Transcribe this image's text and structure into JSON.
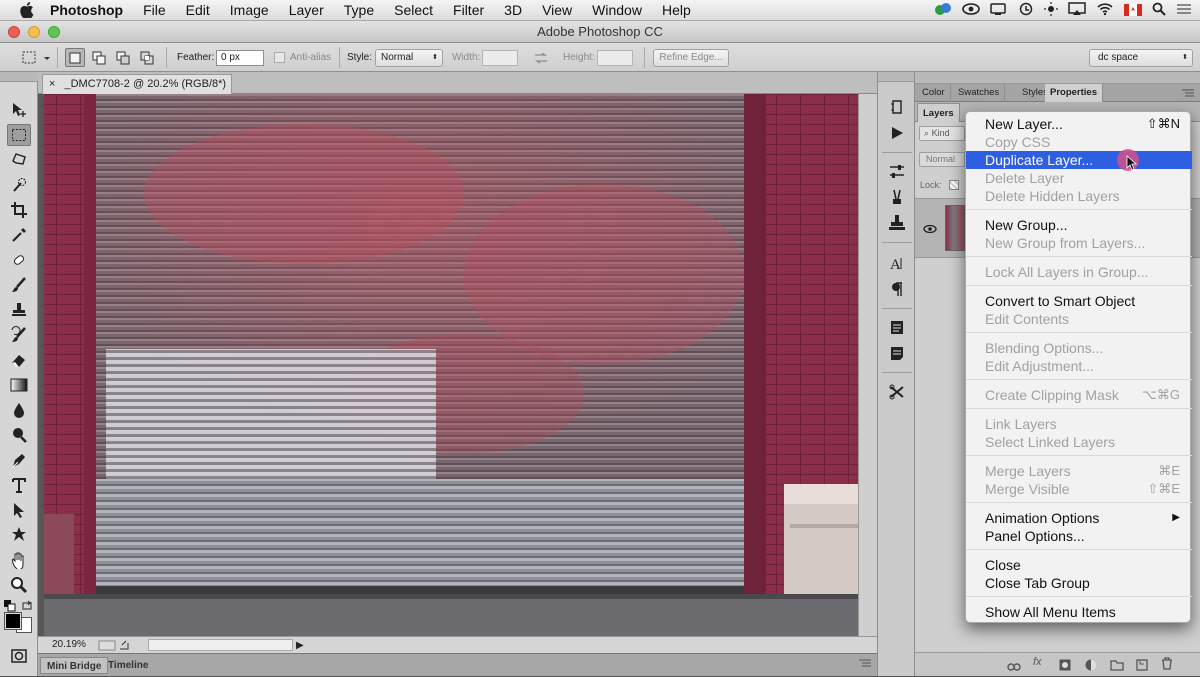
{
  "mac_menubar": {
    "app_name": "Photoshop",
    "items": [
      "File",
      "Edit",
      "Image",
      "Layer",
      "Type",
      "Select",
      "Filter",
      "3D",
      "View",
      "Window",
      "Help"
    ]
  },
  "window": {
    "title": "Adobe Photoshop CC"
  },
  "options_bar": {
    "feather_label": "Feather:",
    "feather_value": "0 px",
    "anti_alias_label": "Anti-alias",
    "style_label": "Style:",
    "style_value": "Normal",
    "width_label": "Width:",
    "height_label": "Height:",
    "refine_edge_label": "Refine Edge...",
    "workspace_value": "dc space"
  },
  "document": {
    "tab_label": "_DMC7708-2 @ 20.2% (RGB/8*)",
    "zoom_display": "20.19%"
  },
  "bottom_tabs": [
    "Mini Bridge",
    "Timeline"
  ],
  "right_panel": {
    "top_tabs": [
      "Color",
      "Swatches",
      "Styles",
      "Properties"
    ],
    "layers_tab": "Layers",
    "kind_label": "Kind",
    "blend_mode": "Normal",
    "lock_label": "Lock:"
  },
  "context_menu": {
    "items": [
      {
        "label": "New Layer...",
        "shortcut": "⇧⌘N",
        "state": "enabled"
      },
      {
        "label": "Copy CSS",
        "shortcut": "",
        "state": "disabled"
      },
      {
        "label": "Duplicate Layer...",
        "shortcut": "",
        "state": "highlighted"
      },
      {
        "label": "Delete Layer",
        "shortcut": "",
        "state": "disabled"
      },
      {
        "label": "Delete Hidden Layers",
        "shortcut": "",
        "state": "disabled"
      },
      {
        "label": "New Group...",
        "shortcut": "",
        "state": "enabled"
      },
      {
        "label": "New Group from Layers...",
        "shortcut": "",
        "state": "disabled"
      },
      {
        "label": "Lock All Layers in Group...",
        "shortcut": "",
        "state": "disabled"
      },
      {
        "label": "Convert to Smart Object",
        "shortcut": "",
        "state": "enabled"
      },
      {
        "label": "Edit Contents",
        "shortcut": "",
        "state": "disabled"
      },
      {
        "label": "Blending Options...",
        "shortcut": "",
        "state": "disabled"
      },
      {
        "label": "Edit Adjustment...",
        "shortcut": "",
        "state": "disabled"
      },
      {
        "label": "Create Clipping Mask",
        "shortcut": "⌥⌘G",
        "state": "disabled"
      },
      {
        "label": "Link Layers",
        "shortcut": "",
        "state": "disabled"
      },
      {
        "label": "Select Linked Layers",
        "shortcut": "",
        "state": "disabled"
      },
      {
        "label": "Merge Layers",
        "shortcut": "⌘E",
        "state": "disabled"
      },
      {
        "label": "Merge Visible",
        "shortcut": "⇧⌘E",
        "state": "disabled"
      },
      {
        "label": "Animation Options",
        "shortcut": "▶",
        "state": "enabled"
      },
      {
        "label": "Panel Options...",
        "shortcut": "",
        "state": "enabled"
      },
      {
        "label": "Close",
        "shortcut": "",
        "state": "enabled"
      },
      {
        "label": "Close Tab Group",
        "shortcut": "",
        "state": "enabled"
      },
      {
        "label": "Show All Menu Items",
        "shortcut": "",
        "state": "enabled"
      }
    ]
  },
  "icons": {
    "toolbar": [
      "move-icon",
      "marquee-icon",
      "lasso-icon",
      "quick-select-icon",
      "crop-icon",
      "eyedropper-icon",
      "healing-brush-icon",
      "brush-icon",
      "clone-stamp-icon",
      "history-brush-icon",
      "eraser-icon",
      "gradient-icon",
      "blur-icon",
      "dodge-icon",
      "pen-icon",
      "type-icon",
      "path-select-icon",
      "shape-icon",
      "hand-icon",
      "zoom-icon"
    ],
    "dock": [
      "history-icon",
      "actions-icon",
      "adjustments-icon",
      "brush-presets-icon",
      "clone-source-icon",
      "character-icon",
      "paragraph-icon",
      "notes-icon",
      "info-icon",
      "tool-presets-icon"
    ]
  },
  "colors": {
    "menu_highlight": "#2e5ee1",
    "foreground_swatch": "#000000",
    "background_swatch": "#ffffff"
  }
}
